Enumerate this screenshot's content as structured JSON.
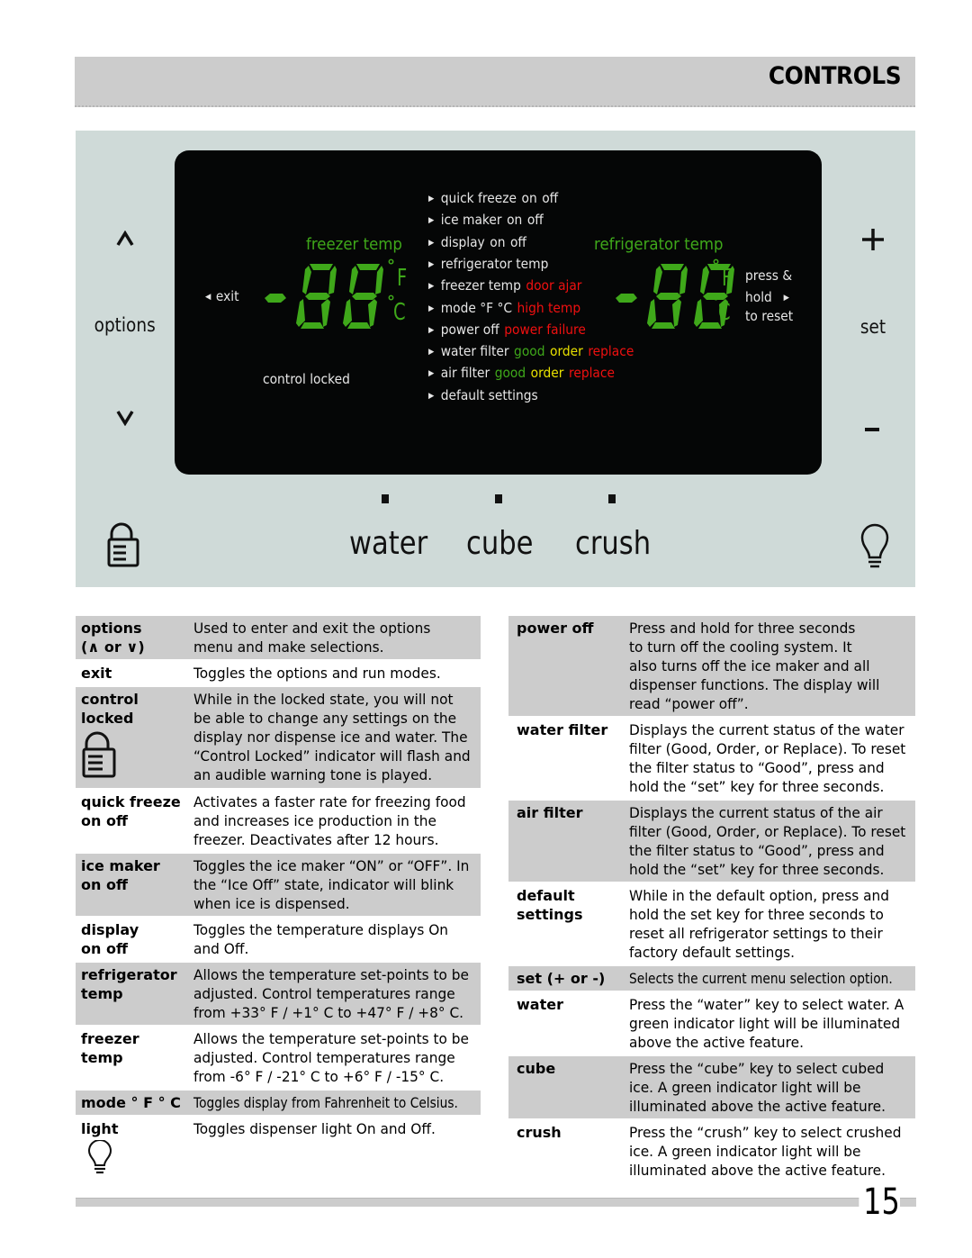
{
  "header": {
    "title": "CONTROLS"
  },
  "panel": {
    "left_controls": {
      "up_symbol": "^",
      "label": "options",
      "down_symbol": "v"
    },
    "right_controls": {
      "plus_symbol": "+",
      "label": "set",
      "minus_symbol": "-"
    },
    "lcd": {
      "exit_label": "exit",
      "control_locked_label": "control locked",
      "freezer_temp_label": "freezer temp",
      "refrigerator_temp_label": "refrigerator temp",
      "freezer_display": "-88",
      "refrigerator_display": "-88",
      "unit_f": "F",
      "unit_c": "C",
      "press_hold": [
        "press &",
        "hold",
        "to reset"
      ],
      "menu": [
        {
          "label": "quick freeze",
          "extras": [
            {
              "text": "on",
              "color": "white"
            },
            {
              "text": "off",
              "color": "white"
            }
          ]
        },
        {
          "label": "ice maker",
          "extras": [
            {
              "text": "on",
              "color": "white"
            },
            {
              "text": "off",
              "color": "white"
            }
          ]
        },
        {
          "label": "display",
          "extras": [
            {
              "text": "on",
              "color": "white"
            },
            {
              "text": "off",
              "color": "white"
            }
          ]
        },
        {
          "label": "refrigerator temp",
          "extras": []
        },
        {
          "label": "freezer temp",
          "extras": [
            {
              "text": "door ajar",
              "color": "red"
            }
          ]
        },
        {
          "label": "mode °F °C",
          "extras": [
            {
              "text": "high temp",
              "color": "red"
            }
          ]
        },
        {
          "label": "power off",
          "extras": [
            {
              "text": "power failure",
              "color": "red"
            }
          ]
        },
        {
          "label": "water filter",
          "extras": [
            {
              "text": "good",
              "color": "green"
            },
            {
              "text": "order",
              "color": "yellow"
            },
            {
              "text": "replace",
              "color": "red"
            }
          ]
        },
        {
          "label": "air filter",
          "extras": [
            {
              "text": "good",
              "color": "green"
            },
            {
              "text": "order",
              "color": "yellow"
            },
            {
              "text": "replace",
              "color": "red"
            }
          ]
        },
        {
          "label": "default settings",
          "extras": []
        }
      ]
    },
    "dispenser": {
      "water": "water",
      "cube": "cube",
      "crush": "crush"
    },
    "colors": {
      "lcd_green": "#3fa81a",
      "status_red": "#f01010",
      "status_yellow": "#e8e000",
      "panel_bg": "#cfdad8"
    }
  },
  "left_table": [
    {
      "key": [
        "options",
        "(∧ or ∨)"
      ],
      "value": [
        "Used to enter and exit the options",
        "menu and make selections."
      ],
      "shade": "gray"
    },
    {
      "key": [
        "exit"
      ],
      "value": [
        "Toggles the options and run modes."
      ],
      "shade": "white"
    },
    {
      "key": [
        "control",
        "locked"
      ],
      "value": [
        "While in the locked state, you will not",
        "be able to change any settings on the",
        "display nor dispense ice and water. The",
        "“Control Locked” indicator will flash and",
        "an audible warning tone is played."
      ],
      "shade": "gray",
      "icon": "lock-icon"
    },
    {
      "key": [
        "quick freeze",
        "on off"
      ],
      "value": [
        "Activates a faster rate for freezing food",
        "and increases ice production in the",
        "freezer. Deactivates after 12 hours."
      ],
      "shade": "white"
    },
    {
      "key": [
        "ice maker",
        "on off"
      ],
      "value": [
        "Toggles the ice maker “ON” or “OFF”. In",
        "the “Ice Off” state, indicator will blink",
        "when ice is dispensed."
      ],
      "shade": "gray"
    },
    {
      "key": [
        "display",
        "on off"
      ],
      "value": [
        "Toggles the temperature displays On",
        "and Off."
      ],
      "shade": "white"
    },
    {
      "key": [
        "refrigerator",
        "temp"
      ],
      "value": [
        "Allows the temperature set-points to be",
        "adjusted. Control temperatures range",
        "from +33° F / +1° C to +47° F / +8° C."
      ],
      "shade": "gray"
    },
    {
      "key": [
        "freezer",
        "temp"
      ],
      "value": [
        "Allows the temperature set-points to be",
        "adjusted. Control temperatures range",
        "from -6° F / -21° C to +6° F / -15° C."
      ],
      "shade": "white"
    },
    {
      "key": [
        "mode ° F ° C"
      ],
      "value": [
        "Toggles display from Fahrenheit to Celsius."
      ],
      "shade": "gray"
    },
    {
      "key": [
        "light"
      ],
      "value": [
        "Toggles dispenser light On and Off."
      ],
      "shade": "white",
      "icon": "light-bulb-icon"
    }
  ],
  "right_table": [
    {
      "key": [
        "power off"
      ],
      "value": [
        "Press and hold for three seconds",
        "to turn off the cooling system. It",
        "also turns off the ice maker and all",
        "dispenser functions. The display will",
        "read “power off”."
      ],
      "shade": "gray"
    },
    {
      "key": [
        "water filter"
      ],
      "value": [
        "Displays the current status of the water",
        "filter (Good, Order, or Replace). To reset",
        "the filter status to “Good”, press and",
        "hold the “set” key for three seconds."
      ],
      "shade": "white"
    },
    {
      "key": [
        "air filter"
      ],
      "value": [
        "Displays the current status of the air",
        "filter (Good, Order, or Replace). To reset",
        "the filter status to “Good”, press and",
        "hold the “set” key for three seconds."
      ],
      "shade": "gray"
    },
    {
      "key": [
        "default",
        "settings"
      ],
      "value": [
        "While in the default option, press and",
        "hold the set key for three seconds to",
        "reset all refrigerator settings to their",
        "factory default settings."
      ],
      "shade": "white"
    },
    {
      "key": [
        "set (+ or -)"
      ],
      "value": [
        "Selects the current menu selection option."
      ],
      "shade": "gray"
    },
    {
      "key": [
        "water"
      ],
      "value": [
        "Press the “water” key to select water. A",
        "green indicator light will be illuminated",
        "above the active feature."
      ],
      "shade": "white"
    },
    {
      "key": [
        "cube"
      ],
      "value": [
        "Press the “cube” key to select cubed",
        "ice. A green indicator light will be",
        "illuminated above the active feature."
      ],
      "shade": "gray"
    },
    {
      "key": [
        "crush"
      ],
      "value": [
        "Press the “crush” key to select crushed",
        "ice. A green indicator light will be",
        "illuminated above the active feature."
      ],
      "shade": "white"
    }
  ],
  "footer": {
    "page_number": "15"
  }
}
